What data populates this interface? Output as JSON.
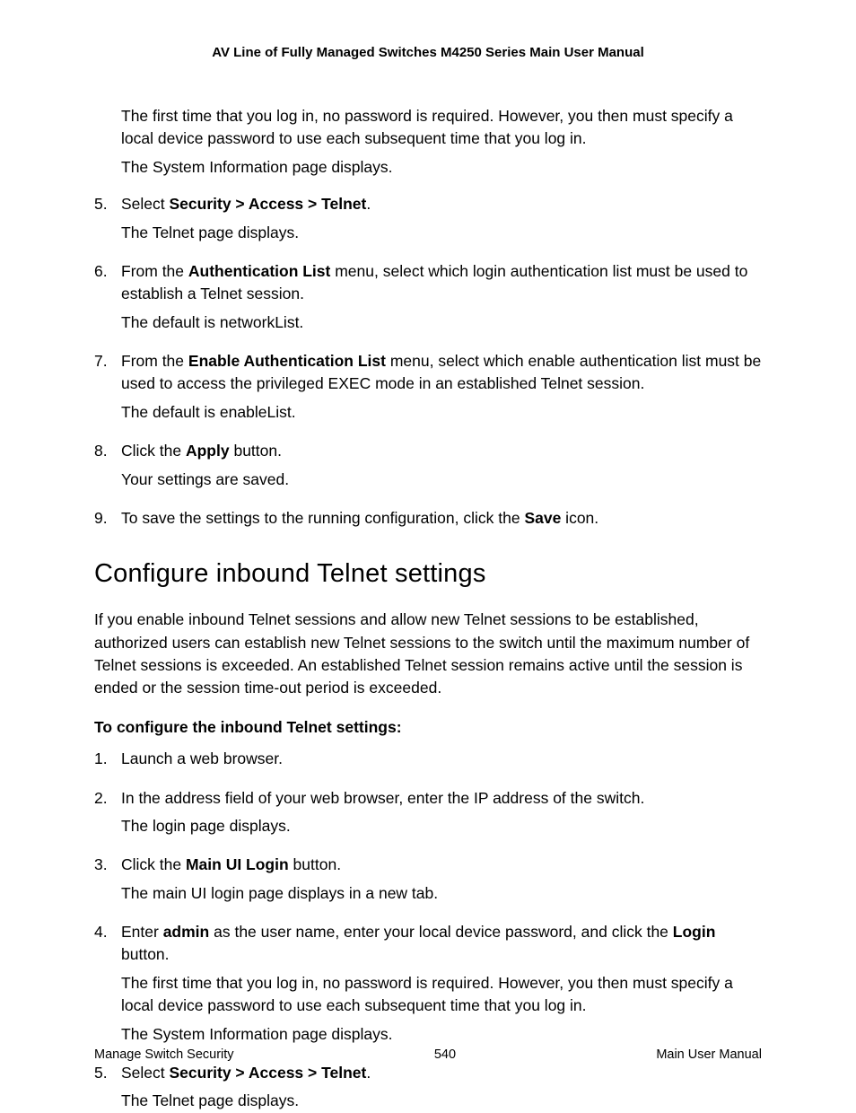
{
  "header": {
    "title": "AV Line of Fully Managed Switches M4250 Series Main User Manual"
  },
  "intro": {
    "para1": "The first time that you log in, no password is required. However, you then must specify a local device password to use each subsequent time that you log in.",
    "para2": "The System Information page displays."
  },
  "topSteps": [
    {
      "num": "5.",
      "parts": [
        {
          "type": "line",
          "pre": "Select ",
          "bold": "Security > Access > Telnet",
          "post": "."
        },
        {
          "type": "plain",
          "text": "The Telnet page displays."
        }
      ]
    },
    {
      "num": "6.",
      "parts": [
        {
          "type": "line",
          "pre": "From the ",
          "bold": "Authentication List",
          "post": " menu, select which login authentication list must be used to establish a Telnet session."
        },
        {
          "type": "plain",
          "text": "The default is networkList."
        }
      ]
    },
    {
      "num": "7.",
      "parts": [
        {
          "type": "line",
          "pre": "From the ",
          "bold": "Enable Authentication List",
          "post": " menu, select which enable authentication list must be used to access the privileged EXEC mode in an established Telnet session."
        },
        {
          "type": "plain",
          "text": "The default is enableList."
        }
      ]
    },
    {
      "num": "8.",
      "parts": [
        {
          "type": "line",
          "pre": "Click the ",
          "bold": "Apply",
          "post": " button."
        },
        {
          "type": "plain",
          "text": "Your settings are saved."
        }
      ]
    },
    {
      "num": "9.",
      "parts": [
        {
          "type": "line",
          "pre": "To save the settings to the running configuration, click the ",
          "bold": "Save",
          "post": " icon."
        }
      ]
    }
  ],
  "section": {
    "title": "Configure inbound Telnet settings",
    "intro": "If you enable inbound Telnet sessions and allow new Telnet sessions to be established, authorized users can establish new Telnet sessions to the switch until the maximum number of Telnet sessions is exceeded. An established Telnet session remains active until the session is ended or the session time-out period is exceeded.",
    "subheading": "To configure the inbound Telnet settings:"
  },
  "bottomSteps": [
    {
      "num": "1.",
      "parts": [
        {
          "type": "plain",
          "text": "Launch a web browser."
        }
      ]
    },
    {
      "num": "2.",
      "parts": [
        {
          "type": "plain",
          "text": "In the address field of your web browser, enter the IP address of the switch."
        },
        {
          "type": "plain",
          "text": "The login page displays."
        }
      ]
    },
    {
      "num": "3.",
      "parts": [
        {
          "type": "line",
          "pre": "Click the ",
          "bold": "Main UI Login",
          "post": " button."
        },
        {
          "type": "plain",
          "text": "The main UI login page displays in a new tab."
        }
      ]
    },
    {
      "num": "4.",
      "parts": [
        {
          "type": "line2",
          "pre": "Enter ",
          "bold": "admin",
          "mid": " as the user name, enter your local device password, and click the ",
          "bold2": "Login",
          "post": " button."
        },
        {
          "type": "plain",
          "text": "The first time that you log in, no password is required. However, you then must specify a local device password to use each subsequent time that you log in."
        },
        {
          "type": "plain",
          "text": "The System Information page displays."
        }
      ]
    },
    {
      "num": "5.",
      "parts": [
        {
          "type": "line",
          "pre": "Select ",
          "bold": "Security > Access > Telnet",
          "post": "."
        },
        {
          "type": "plain",
          "text": "The Telnet page displays."
        }
      ]
    }
  ],
  "footer": {
    "left": "Manage Switch Security",
    "center": "540",
    "right": "Main User Manual"
  }
}
